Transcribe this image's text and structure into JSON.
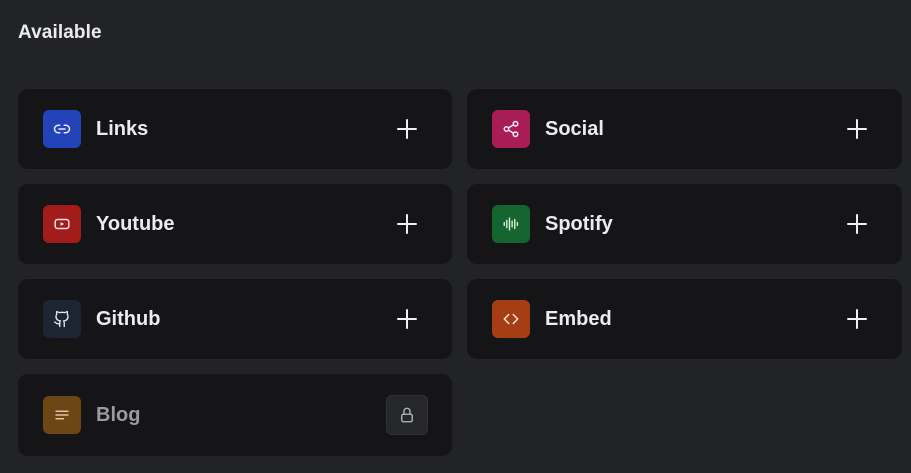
{
  "section": {
    "title": "Available"
  },
  "cards": [
    {
      "label": "Links",
      "icon": "link-icon",
      "color": "#2343b8",
      "locked": false
    },
    {
      "label": "Social",
      "icon": "share-icon",
      "color": "#a81d55",
      "locked": false
    },
    {
      "label": "Youtube",
      "icon": "youtube-icon",
      "color": "#a31c1c",
      "locked": false
    },
    {
      "label": "Spotify",
      "icon": "audio-wave-icon",
      "color": "#15652f",
      "locked": false
    },
    {
      "label": "Github",
      "icon": "github-icon",
      "color": "#1d2532",
      "locked": false
    },
    {
      "label": "Embed",
      "icon": "code-icon",
      "color": "#a53e14",
      "locked": false
    },
    {
      "label": "Blog",
      "icon": "text-lines-icon",
      "color": "#6d4616",
      "locked": true
    }
  ]
}
